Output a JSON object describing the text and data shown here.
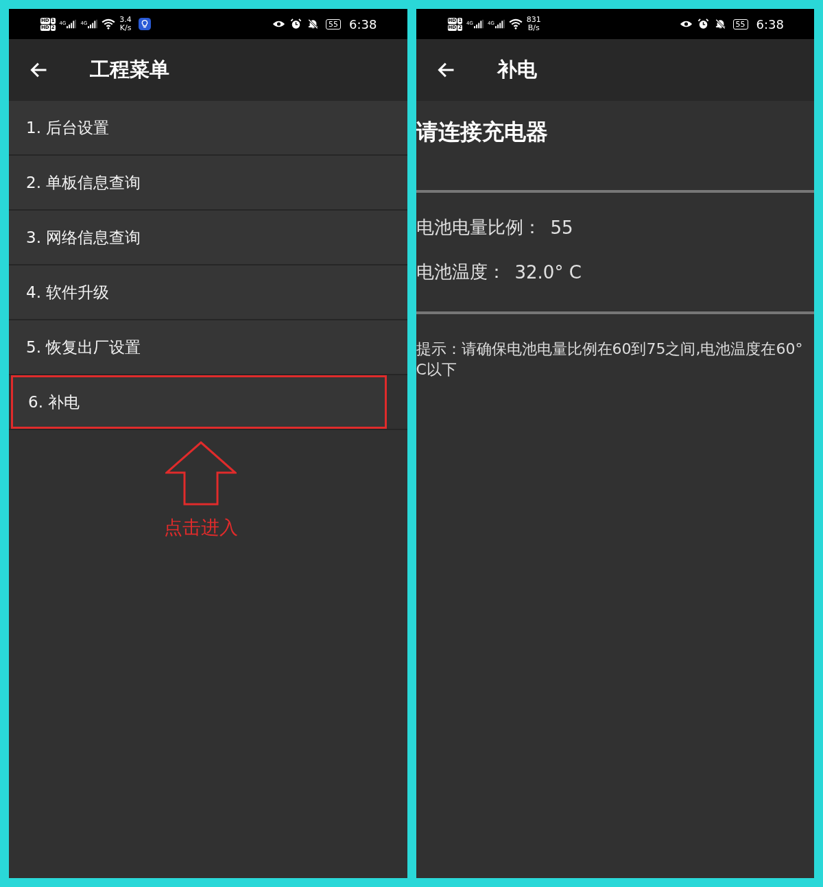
{
  "screens": [
    {
      "status_bar": {
        "sims": [
          {
            "badge": "HD",
            "slot": "1"
          },
          {
            "badge": "HD",
            "slot": "2"
          }
        ],
        "networks": [
          "4G",
          "4G"
        ],
        "speed": [
          "3.4",
          "K/s"
        ],
        "app_notification": true,
        "battery": "55",
        "time": "6:38"
      },
      "title": "工程菜单",
      "menu": [
        {
          "label": "1. 后台设置",
          "highlighted": false
        },
        {
          "label": "2. 单板信息查询",
          "highlighted": false
        },
        {
          "label": "3. 网络信息查询",
          "highlighted": false
        },
        {
          "label": "4. 软件升级",
          "highlighted": false
        },
        {
          "label": "5. 恢复出厂设置",
          "highlighted": false
        },
        {
          "label": "6. 补电",
          "highlighted": true
        }
      ],
      "annotation": {
        "caption": "点击进入"
      }
    },
    {
      "status_bar": {
        "sims": [
          {
            "badge": "HD",
            "slot": "1"
          },
          {
            "badge": "HD",
            "slot": "2"
          }
        ],
        "networks": [
          "4G",
          "4G"
        ],
        "speed": [
          "831",
          "B/s"
        ],
        "app_notification": false,
        "battery": "55",
        "time": "6:38"
      },
      "title": "补电",
      "heading": "请连接充电器",
      "readings": [
        {
          "label": "电池电量比例：",
          "value": "55"
        },
        {
          "label": "电池温度：",
          "value": "32.0° C"
        }
      ],
      "tip": "提示：请确保电池电量比例在60到75之间,电池温度在60°C以下"
    }
  ]
}
